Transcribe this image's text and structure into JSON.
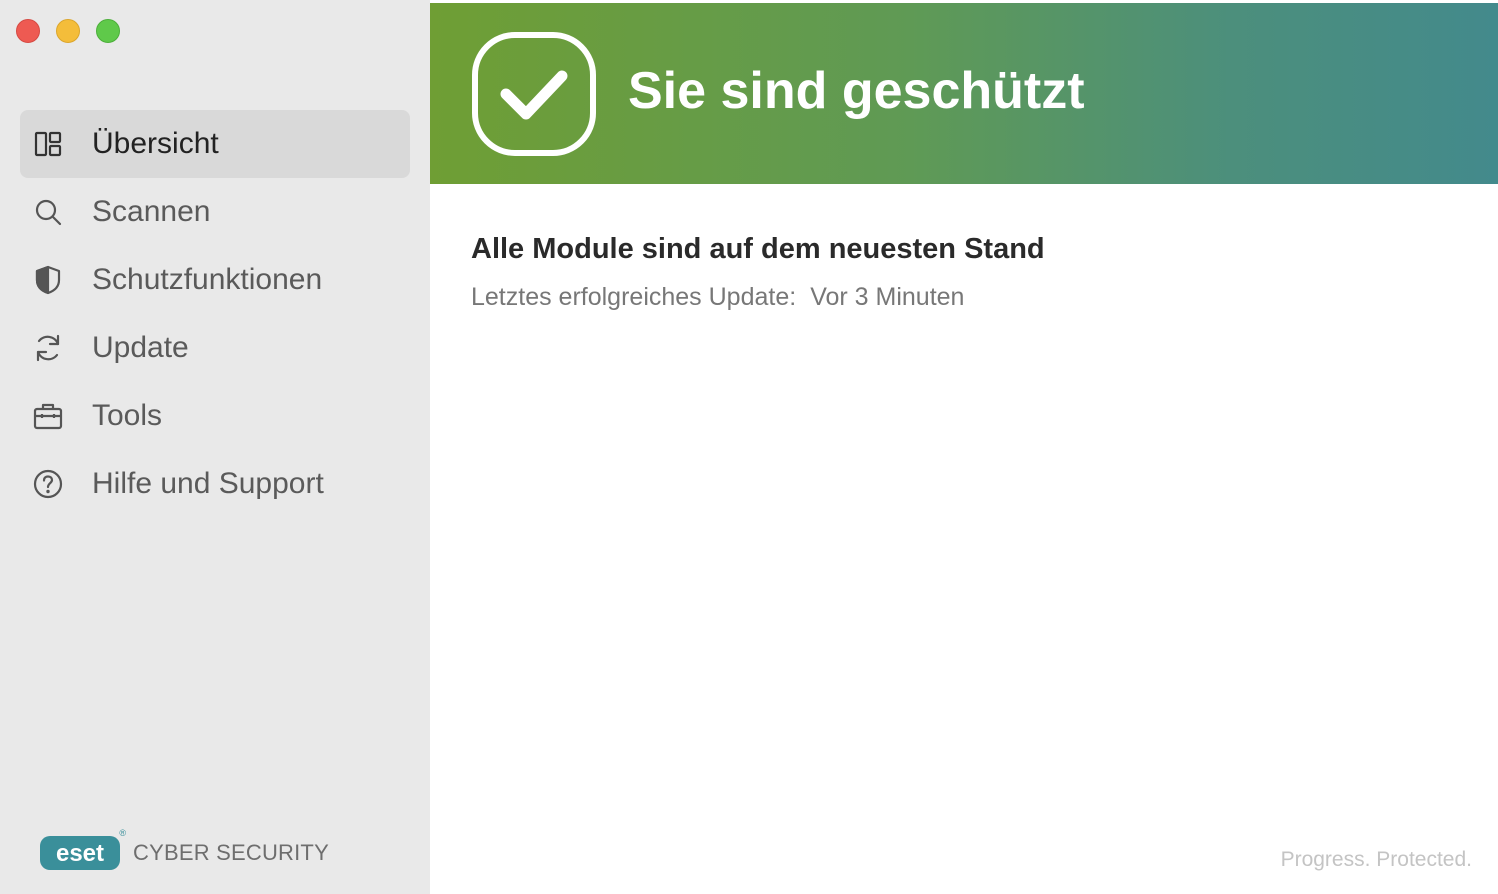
{
  "window": {
    "controls": [
      "close",
      "minimize",
      "zoom"
    ]
  },
  "sidebar": {
    "items": [
      {
        "label": "Übersicht",
        "icon": "dashboard-icon",
        "active": true
      },
      {
        "label": "Scannen",
        "icon": "search-icon",
        "active": false
      },
      {
        "label": "Schutzfunktionen",
        "icon": "shield-icon",
        "active": false
      },
      {
        "label": "Update",
        "icon": "refresh-icon",
        "active": false
      },
      {
        "label": "Tools",
        "icon": "briefcase-icon",
        "active": false
      },
      {
        "label": "Hilfe und Support",
        "icon": "help-icon",
        "active": false
      }
    ],
    "logo": {
      "brand": "eset",
      "product": "CYBER SECURITY",
      "registered": "®"
    }
  },
  "banner": {
    "title": "Sie sind geschützt",
    "icon": "checkmark-icon"
  },
  "status": {
    "heading": "Alle Module sind auf dem neuesten Stand",
    "label": "Letztes erfolgreiches Update:",
    "value": "Vor 3 Minuten"
  },
  "footer": {
    "tagline": "Progress. Protected."
  },
  "colors": {
    "banner_start": "#6f9e34",
    "banner_end": "#438a8c",
    "sidebar_bg": "#e9e9e9",
    "brand": "#3a8f9a"
  }
}
